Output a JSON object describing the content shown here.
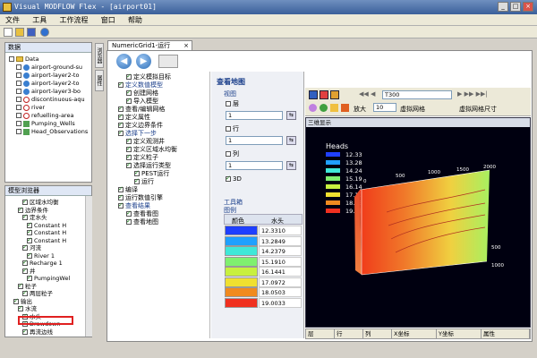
{
  "window": {
    "title": "Visual MODFLOW Flex - [airport01]",
    "controls": [
      "_",
      "□",
      "×"
    ]
  },
  "menu": {
    "items": [
      "文件",
      "工具",
      "工作流程",
      "窗口",
      "帮助"
    ]
  },
  "data_panel": {
    "title": "数据",
    "root": "Data",
    "items": [
      {
        "label": "airport-ground-su",
        "icon": "globe-icon"
      },
      {
        "label": "airport-layer2-to",
        "icon": "globe-icon"
      },
      {
        "label": "airport-layer2-to",
        "icon": "globe-icon"
      },
      {
        "label": "airport-layer3-bo",
        "icon": "globe-icon"
      },
      {
        "label": "discontinuous-aqu",
        "icon": "ring-icon"
      },
      {
        "label": "river",
        "icon": "ring-icon"
      },
      {
        "label": "refuelling-area",
        "icon": "ring-icon"
      },
      {
        "label": "Pumping_Wells",
        "icon": "point-icon"
      },
      {
        "label": "Head_Observations",
        "icon": "point-icon"
      }
    ]
  },
  "model_panel": {
    "title": "模型浏览器",
    "rows": [
      "区域水均衡",
      "边界条件",
      "定水头",
      "Constant H",
      "Constant H",
      "Constant H",
      "河流",
      "River 1",
      "Recharge 1",
      "井",
      "PumpingWel",
      "粒子",
      "两层粒子",
      "输出",
      "水流",
      "水头",
      "Drawdown",
      "再流边线"
    ]
  },
  "side_tabs": [
    "浏览器",
    "属性"
  ],
  "doc_tab": {
    "label": "NumericGrid1-运行",
    "close": "×"
  },
  "workflow": {
    "rows": [
      {
        "label": "定义模拟目标",
        "indent": 1,
        "checked": true
      },
      {
        "label": "定义数值模型",
        "indent": 0,
        "checked": true,
        "section": true
      },
      {
        "label": "创建网格",
        "indent": 1,
        "checked": true
      },
      {
        "label": "导入模型",
        "indent": 1,
        "checked": true
      },
      {
        "label": "查看/编辑网格",
        "indent": 0,
        "checked": true
      },
      {
        "label": "定义属性",
        "indent": 0,
        "checked": true
      },
      {
        "label": "定义边界条件",
        "indent": 0,
        "checked": true
      },
      {
        "label": "选择下一步",
        "indent": 0,
        "checked": true,
        "section": true
      },
      {
        "label": "定义观测井",
        "indent": 1,
        "checked": true
      },
      {
        "label": "定义区域水均衡",
        "indent": 1,
        "checked": true
      },
      {
        "label": "定义粒子",
        "indent": 1,
        "checked": true
      },
      {
        "label": "选择运行类型",
        "indent": 1,
        "checked": true
      },
      {
        "label": "PEST运行",
        "indent": 2,
        "checked": true
      },
      {
        "label": "运行",
        "indent": 2,
        "checked": true
      },
      {
        "label": "编译",
        "indent": 0,
        "checked": true
      },
      {
        "label": "运行数值引擎",
        "indent": 0,
        "checked": true
      },
      {
        "label": "查看结果",
        "indent": 0,
        "checked": true,
        "section": true
      },
      {
        "label": "查看看图",
        "indent": 1,
        "checked": true
      },
      {
        "label": "查看地图",
        "indent": 1,
        "checked": true
      }
    ]
  },
  "view_panel": {
    "title": "查看地图",
    "view_group": "视图",
    "layer_label": "层",
    "layer_value": "1",
    "row_label": "行",
    "row_value": "1",
    "col_label": "列",
    "col_value": "1",
    "three_d_label": "3D",
    "toolbox_title": "工具箱",
    "legend_title": "图例",
    "legend_col_color": "颜色",
    "legend_col_head": "水头"
  },
  "legend": [
    {
      "color": "#1f3fff",
      "value": "12.3310"
    },
    {
      "color": "#1fa0ff",
      "value": "13.2849"
    },
    {
      "color": "#3fe8d8",
      "value": "14.2379"
    },
    {
      "color": "#7ff06f",
      "value": "15.1910"
    },
    {
      "color": "#c8f03f",
      "value": "16.1441"
    },
    {
      "color": "#f0e030",
      "value": "17.0972"
    },
    {
      "color": "#f08a1f",
      "value": "18.0503"
    },
    {
      "color": "#f0301f",
      "value": "19.0033"
    }
  ],
  "viewer_toolbar": {
    "time_value": "T300",
    "zoom_label": "放大",
    "zoom_value": "10",
    "grid_label": "虚拟网格",
    "grid_size_label": "虚拟网格尺寸"
  },
  "viewer": {
    "title": "三维显示",
    "heads_title": "Heads",
    "heads_values": [
      "12.33",
      "13.28",
      "14.24",
      "15.19",
      "16.14",
      "17.10",
      "18.05",
      "19.00"
    ],
    "heads_colors": [
      "#2040ff",
      "#20a0ff",
      "#40e8d8",
      "#80f070",
      "#c8f040",
      "#f0e030",
      "#f08a20",
      "#f03020"
    ],
    "axis_labels": [
      "0",
      "500",
      "1000",
      "1500",
      "2000"
    ],
    "side_labels": [
      "500",
      "1000"
    ]
  },
  "status_bar": {
    "cells": [
      "层",
      "行",
      "列",
      "X坐标",
      "Y坐标",
      "属性"
    ]
  }
}
